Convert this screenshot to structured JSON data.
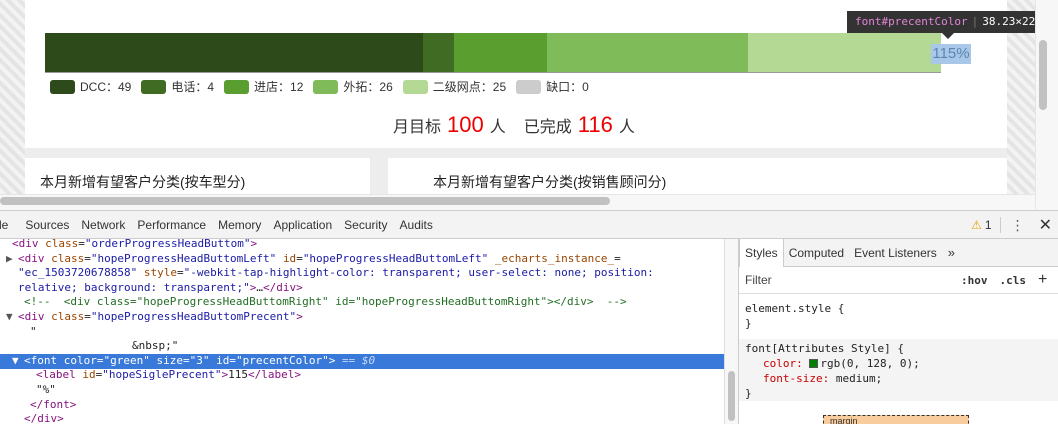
{
  "chart_data": {
    "type": "bar",
    "series": [
      {
        "name": "DCC",
        "value": 49,
        "color": "#2d4a1a"
      },
      {
        "name": "电话",
        "value": 4,
        "color": "#3f6b22"
      },
      {
        "name": "进店",
        "value": 12,
        "color": "#5a9e2f"
      },
      {
        "name": "外拓",
        "value": 26,
        "color": "#7fbc59"
      },
      {
        "name": "二级网点",
        "value": 25,
        "color": "#b3d995"
      },
      {
        "name": "缺口",
        "value": 0,
        "color": "#cccccc"
      }
    ],
    "legend_labels": [
      "DCC：49",
      "电话：4",
      "进店：12",
      "外拓：26",
      "二级网点：25",
      "缺口：0"
    ]
  },
  "page": {
    "percent_label": "115%",
    "tooltip": {
      "tag": "font",
      "selector": "#precentColor",
      "size": "38.23×22"
    },
    "target": {
      "prefix": "月目标",
      "target_value": "100",
      "target_unit": "人",
      "done_prefix": "已完成",
      "done_value": "116",
      "done_unit": "人"
    },
    "card_left_title": "本月新增有望客户分类(按车型分)",
    "card_right_title": "本月新增有望客户分类(按销售顾问分)"
  },
  "devtools": {
    "tabs": [
      "le",
      "Sources",
      "Network",
      "Performance",
      "Memory",
      "Application",
      "Security",
      "Audits"
    ],
    "warning_count": "1",
    "warning_icon": "⚠",
    "kebab": "⋮",
    "close": "✕",
    "elements_lines": [
      {
        "indent": 0,
        "html": "<span class=\"tag\">&lt;div</span> <span class=\"attr\">class</span>=<span class=\"val\">\"orderProgressHeadButtom\"</span><span class=\"tag\">&gt;</span>"
      },
      {
        "indent": 1,
        "tri": "▶",
        "html": "<span class=\"tag\">&lt;div</span> <span class=\"attr\">class</span>=<span class=\"val\">\"hopeProgressHeadButtomLeft\"</span> <span class=\"attr\">id</span>=<span class=\"val\">\"hopeProgressHeadButtomLeft\"</span> <span class=\"attr\">_echarts_instance_</span>="
      },
      {
        "indent": 1,
        "html": "<span class=\"val\">\"ec_1503720678858\"</span> <span class=\"attr\">style</span>=<span class=\"val\">\"-webkit-tap-highlight-color: transparent; user-select: none; position:</span>"
      },
      {
        "indent": 1,
        "html": "<span class=\"val\">relative; background: transparent;\"</span><span class=\"tag\">&gt;</span>…<span class=\"tag\">&lt;/div&gt;</span>"
      },
      {
        "indent": 2,
        "html": "<span class=\"cmt\">&lt;!--  &lt;div class=\"hopeProgressHeadButtomRight\" id=\"hopeProgressHeadButtomRight\"&gt;&lt;/div&gt;  --&gt;</span>"
      },
      {
        "indent": 1,
        "tri": "▼",
        "html": "<span class=\"tag\">&lt;div</span> <span class=\"attr\">class</span>=<span class=\"val\">\"hopeProgressHeadButtomPrecent\"</span><span class=\"tag\">&gt;</span>"
      },
      {
        "indent": 3,
        "html": "\""
      },
      {
        "indent": 20,
        "html": "&amp;nbsp;\""
      },
      {
        "indent": 2,
        "tri": "▼",
        "selected": true,
        "html": "<span class=\"tag\">&lt;font</span> <span class=\"attr\">color</span>=<span class=\"val\">\"green\"</span> <span class=\"attr\">size</span>=<span class=\"val\">\"3\"</span> <span class=\"attr\">id</span>=<span class=\"val\">\"precentColor\"</span><span class=\"tag\">&gt;</span> <span class=\"eq\">== $0</span>"
      },
      {
        "indent": 4,
        "html": "<span class=\"tag\">&lt;label</span> <span class=\"attr\">id</span>=<span class=\"val\">\"hopeSiglePrecent\"</span><span class=\"tag\">&gt;</span>115<span class=\"tag\">&lt;/label&gt;</span>"
      },
      {
        "indent": 4,
        "html": "\"%\""
      },
      {
        "indent": 3,
        "html": "<span class=\"tag\">&lt;/font&gt;</span>"
      },
      {
        "indent": 2,
        "html": "<span class=\"tag\">&lt;/div&gt;</span>"
      }
    ],
    "styles_tabs": [
      "Styles",
      "Computed",
      "Event Listeners"
    ],
    "styles_more": "»",
    "filter_placeholder": "Filter",
    "hov": ":hov",
    "cls": ".cls",
    "plus": "+",
    "element_style_open": "element.style {",
    "element_style_close": "}",
    "font_rule_selector": "font[Attributes Style] {",
    "font_rule_prop1_name": "color:",
    "font_rule_prop1_val": "rgb(0, 128, 0);",
    "font_rule_prop2_name": "font-size:",
    "font_rule_prop2_val": "medium;",
    "font_rule_close": "}",
    "box_model_label": "margin"
  }
}
